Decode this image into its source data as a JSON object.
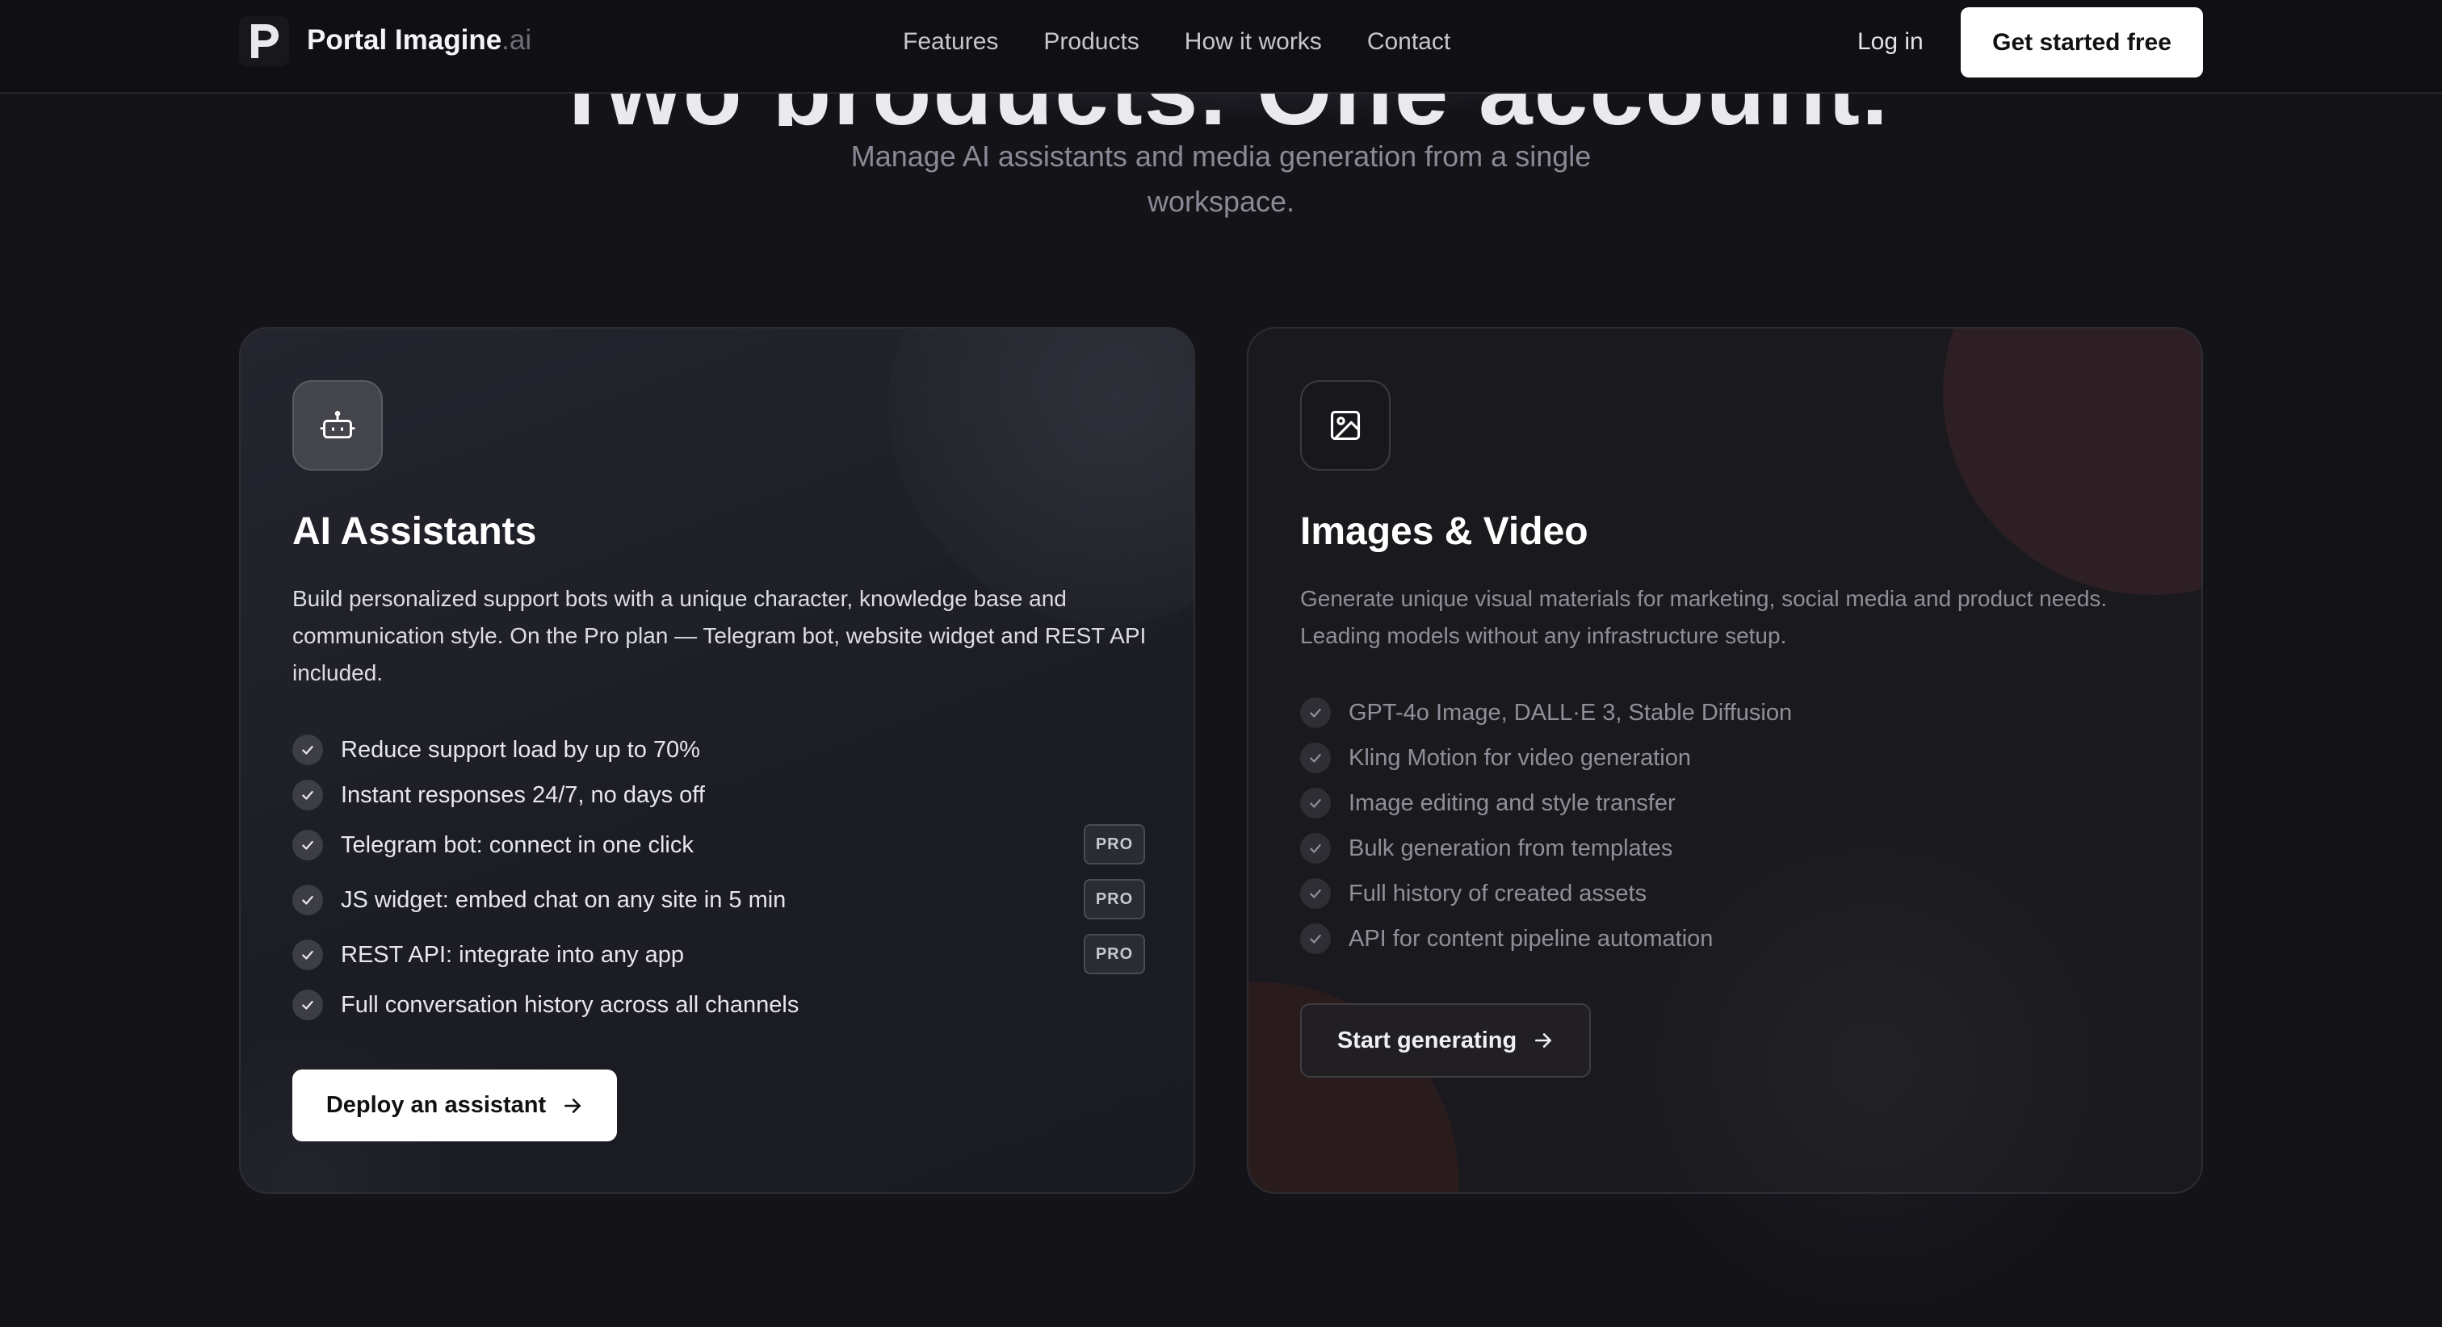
{
  "brand": {
    "name": "Portal Imagine",
    "suffix": ".ai"
  },
  "nav": {
    "links": [
      "Features",
      "Products",
      "How it works",
      "Contact"
    ],
    "login": "Log in",
    "cta": "Get started free"
  },
  "hero": {
    "title_partial": "Two products. One account.",
    "subtitle": "Manage AI assistants and media generation from a single workspace."
  },
  "cards": [
    {
      "icon": "robot-icon",
      "title": "AI Assistants",
      "description": "Build personalized support bots with a unique character, knowledge base and communication style. On the Pro plan — Telegram bot, website widget and REST API included.",
      "features": [
        {
          "text": "Reduce support load by up to 70%",
          "badge": ""
        },
        {
          "text": "Instant responses 24/7, no days off",
          "badge": ""
        },
        {
          "text": "Telegram bot: connect in one click",
          "badge": "PRO"
        },
        {
          "text": "JS widget: embed chat on any site in 5 min",
          "badge": "PRO"
        },
        {
          "text": "REST API: integrate into any app",
          "badge": "PRO"
        },
        {
          "text": "Full conversation history across all channels",
          "badge": ""
        }
      ],
      "button": "Deploy an assistant"
    },
    {
      "icon": "image-icon",
      "title": "Images & Video",
      "description": "Generate unique visual materials for marketing, social media and product needs. Leading models without any infrastructure setup.",
      "features": [
        {
          "text": "GPT-4o Image, DALL·E 3, Stable Diffusion"
        },
        {
          "text": "Kling Motion for video generation"
        },
        {
          "text": "Image editing and style transfer"
        },
        {
          "text": "Bulk generation from templates"
        },
        {
          "text": "Full history of created assets"
        },
        {
          "text": "API for content pipeline automation"
        }
      ],
      "button": "Start generating"
    }
  ],
  "colors": {
    "background": "#131318",
    "accent_button": "#ffffff",
    "card_border": "#2d2d35",
    "blob_red": "#3a2226"
  }
}
